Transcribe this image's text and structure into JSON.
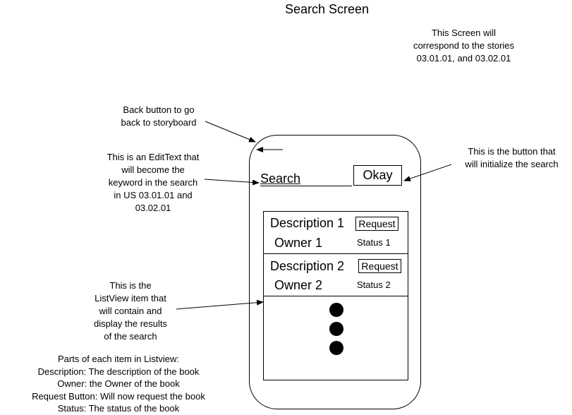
{
  "title": "Search  Screen",
  "stories_note": [
    "This Screen will",
    "correspond to the stories",
    "03.01.01, and 03.02.01"
  ],
  "annotations": {
    "back_button": [
      "Back button to go",
      "back to storyboard"
    ],
    "edit_text": [
      "This is an EditText that",
      "will become the",
      "keyword in the search",
      "in US 03.01.01 and",
      "03.02.01"
    ],
    "okay_button": [
      "This is the button that",
      "will initialize the search"
    ],
    "listview": [
      "This is the",
      "ListView item that",
      "will contain and",
      "display the results",
      "of the search"
    ],
    "parts": [
      "Parts of each item in Listview:",
      "Description: The description of the book",
      "Owner: the Owner of the book",
      "Request Button: Will now request the book",
      "Status: The status of the book"
    ]
  },
  "phone": {
    "search_label": "Search",
    "okay_label": "Okay",
    "items": [
      {
        "description": "Description 1",
        "owner": "Owner 1",
        "request": "Request",
        "status": "Status 1"
      },
      {
        "description": "Description 2",
        "owner": "Owner 2",
        "request": "Request",
        "status": "Status 2"
      }
    ]
  }
}
